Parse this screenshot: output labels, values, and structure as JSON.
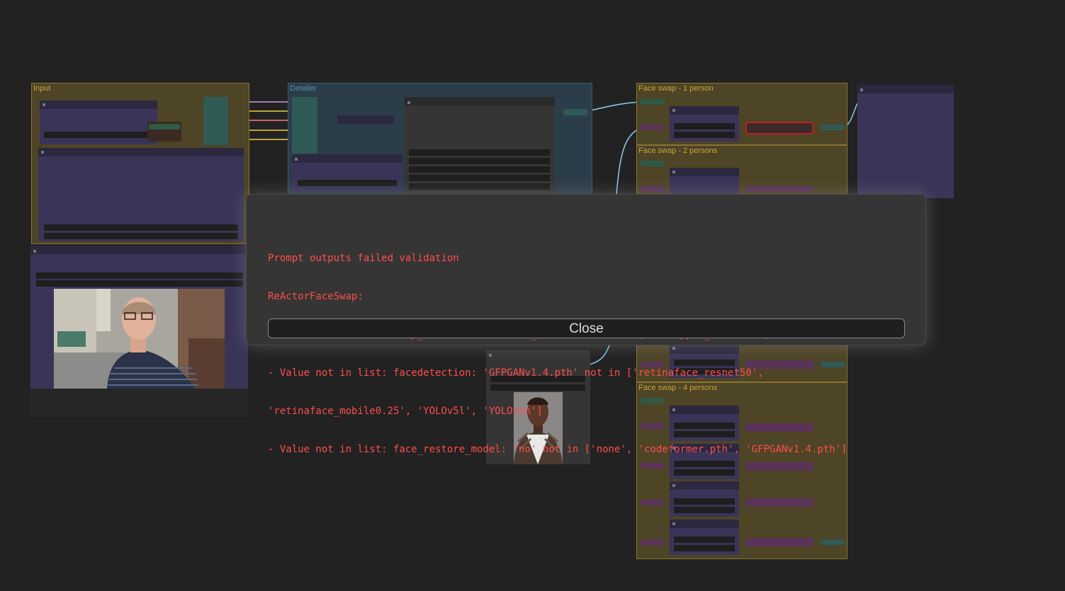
{
  "groups": {
    "input": "Input",
    "detailer": "Detailer",
    "face_swap_1": "Face swap - 1 person",
    "face_swap_2": "Face swap - 2 persons",
    "face_swap_4": "Face swap - 4 persons"
  },
  "dialog": {
    "lines": [
      "Prompt outputs failed validation",
      "ReActorFaceSwap:",
      "- Value not in list: swap_model: 'retinaface_resnet50' not in ['inswapper_128.onnx']",
      "- Value not in list: facedetection: 'GFPGANv1.4.pth' not in ['retinaface_resnet50',",
      "'retinaface_mobile0.25', 'YOLOv5l', 'YOLOv5n']",
      "- Value not in list: face_restore_model: 'no' not in ['none', 'codeformer.pth', 'GFPGANv1.4.pth']"
    ],
    "close_label": "Close"
  },
  "colors": {
    "canvas": "#222222",
    "group_yellow": "#4e4426",
    "group_blue": "#2c3d4a",
    "node_purple": "#3a3558",
    "error_text": "#ff4d4d"
  }
}
